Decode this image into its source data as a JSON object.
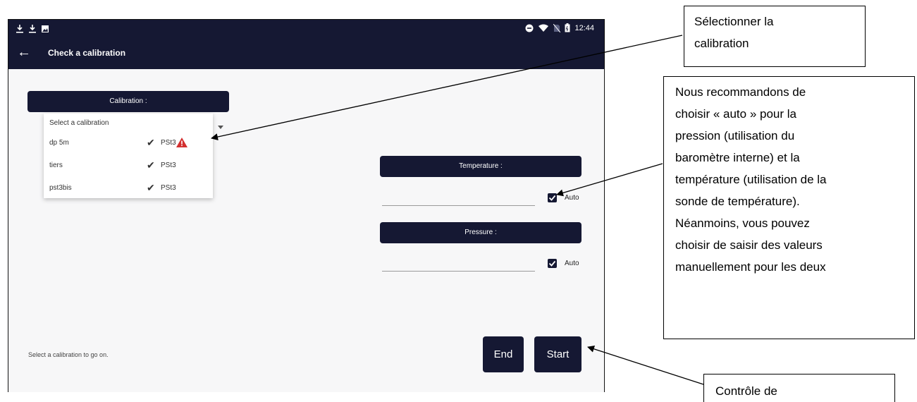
{
  "status_bar": {
    "left_icons": [
      "download-icon",
      "download-icon",
      "image-icon"
    ],
    "right_icons": [
      "do-not-disturb-icon",
      "wifi-icon",
      "no-sim-icon",
      "battery-icon"
    ],
    "time": "12:44"
  },
  "toolbar": {
    "title": "Check a calibration",
    "back_icon": "arrow-left-icon"
  },
  "calibration": {
    "label": "Calibration :",
    "placeholder": "Select a calibration",
    "items": [
      {
        "name": "dp 5m",
        "type": "PSt3",
        "checked": true,
        "warning": true
      },
      {
        "name": "tiers",
        "type": "PSt3",
        "checked": true,
        "warning": false
      },
      {
        "name": "pst3bis",
        "type": "PSt3",
        "checked": true,
        "warning": false
      }
    ]
  },
  "temperature": {
    "label": "Temperature :",
    "value": "",
    "auto_label": "Auto",
    "auto_checked": true
  },
  "pressure": {
    "label": "Pressure :",
    "value": "",
    "auto_label": "Auto",
    "auto_checked": true
  },
  "hint": "Select a calibration to go on.",
  "buttons": {
    "end": "End",
    "start": "Start"
  },
  "callouts": {
    "select": [
      "Sélectionner la",
      "calibration"
    ],
    "recommend": [
      "Nous recommandons de",
      "choisir « auto » pour la",
      "pression (utilisation du",
      "baromètre interne) et la",
      "température (utilisation de la",
      "sonde de température).",
      "Néanmoins, vous pouvez",
      "choisir de saisir des valeurs",
      "manuellement pour les deux"
    ],
    "control": "Contrôle de"
  },
  "colors": {
    "primary": "#151833",
    "background": "#f7f7f8",
    "warning": "#d32f2f"
  }
}
